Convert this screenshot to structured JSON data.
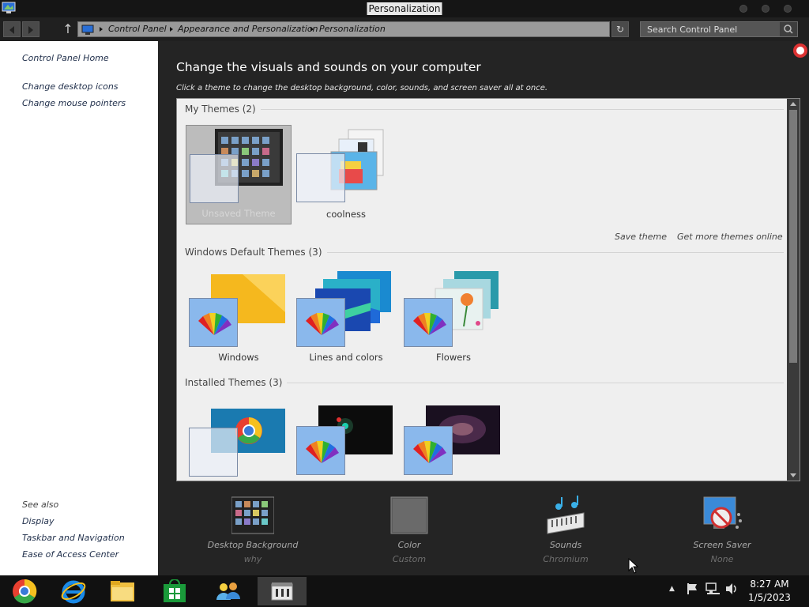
{
  "window": {
    "title": "Personalization"
  },
  "address": {
    "crumbs": [
      "Control Panel",
      "Appearance and Personalization",
      "Personalization"
    ],
    "search_placeholder": "Search Control Panel"
  },
  "leftnav": {
    "home": "Control Panel Home",
    "links": [
      "Change desktop icons",
      "Change mouse pointers"
    ],
    "see_also_title": "See also",
    "see_also": [
      "Display",
      "Taskbar and Navigation",
      "Ease of Access Center"
    ]
  },
  "main": {
    "heading": "Change the visuals and sounds on your computer",
    "subheading": "Click a theme to change the desktop background, color, sounds, and screen saver all at once.",
    "groups": {
      "my_themes": {
        "title": "My Themes (2)",
        "items": [
          "Unsaved Theme",
          "coolness"
        ]
      },
      "default_themes": {
        "title": "Windows Default Themes (3)",
        "items": [
          "Windows",
          "Lines and colors",
          "Flowers"
        ]
      },
      "installed_themes": {
        "title": "Installed Themes (3)"
      }
    },
    "actions": {
      "save": "Save theme",
      "more": "Get more themes online"
    }
  },
  "bottom": [
    {
      "label": "Desktop Background",
      "value": "why",
      "icon": "desktop-background-icon"
    },
    {
      "label": "Color",
      "value": "Custom",
      "icon": "color-icon"
    },
    {
      "label": "Sounds",
      "value": "Chromium",
      "icon": "sounds-icon"
    },
    {
      "label": "Screen Saver",
      "value": "None",
      "icon": "screen-saver-icon"
    }
  ],
  "taskbar": {
    "time": "8:27 AM",
    "date": "1/5/2023",
    "apps": [
      "chrome-icon",
      "internet-explorer-icon",
      "file-explorer-icon",
      "store-icon",
      "people-icon",
      "control-panel-icon"
    ]
  },
  "colors": {
    "accent_blue": "#8ab8ec",
    "panel_bg": "#242424",
    "themes_bg": "#efefef"
  }
}
